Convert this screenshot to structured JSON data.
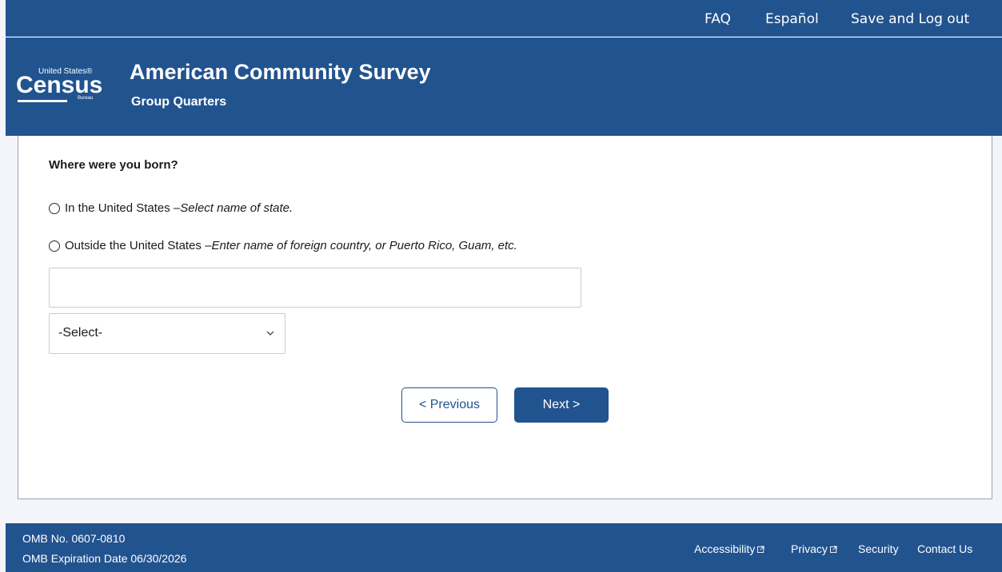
{
  "topnav": {
    "faq": "FAQ",
    "espanol": "Español",
    "save_logout": "Save and Log out"
  },
  "header": {
    "logo": {
      "united_states": "United States®",
      "census": "Census",
      "bureau": "Bureau"
    },
    "title": "American Community Survey",
    "subtitle": "Group Quarters"
  },
  "form": {
    "question": "Where were you born?",
    "option_us": {
      "label": "In the United States – ",
      "hint": "Select name of state."
    },
    "option_outside": {
      "label": "Outside the United States – ",
      "hint": "Enter name of foreign country, or Puerto Rico, Guam, etc."
    },
    "text_input_value": "",
    "select_value": "-Select-"
  },
  "buttons": {
    "previous": "< Previous",
    "next": "Next >"
  },
  "footer": {
    "omb_number": "OMB No. 0607-0810",
    "omb_expiration": "OMB Expiration Date 06/30/2026",
    "links": {
      "accessibility": "Accessibility",
      "privacy": "Privacy",
      "security": "Security",
      "contact": "Contact Us"
    }
  },
  "colors": {
    "brand_blue": "#21538f",
    "page_background": "#f3f5fa",
    "card_background": "#ffffff"
  }
}
